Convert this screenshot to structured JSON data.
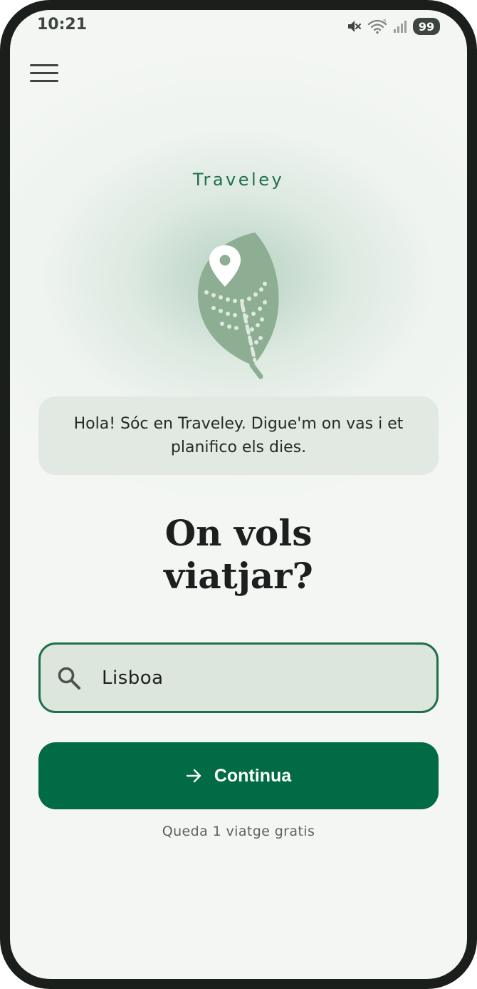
{
  "status_bar": {
    "time": "10:21",
    "battery": "99",
    "icons": [
      "mute-icon",
      "wifi-icon",
      "signal-icon"
    ]
  },
  "header": {
    "menu_icon": "hamburger-menu-icon",
    "brand": "Traveley"
  },
  "logo": {
    "icon": "leaf-map-pin-icon",
    "colors": {
      "leaf": "#8dae93",
      "dots": "#dfeadf",
      "pin": "#ffffff"
    }
  },
  "assistant": {
    "message": "Hola! Sóc en Traveley. Digue'm on vas i et planifico els dies."
  },
  "prompt": {
    "line1": "On vols",
    "line2": "viatjar?"
  },
  "search": {
    "icon": "search-icon",
    "value": "Lisboa",
    "placeholder": ""
  },
  "actions": {
    "continue_label": "Continua",
    "continue_icon": "arrow-right-icon",
    "remaining_trips": "Queda 1 viatge gratis"
  },
  "colors": {
    "accent": "#006b45",
    "brand_text": "#1f6f4a",
    "background": "#f3f6f3",
    "bubble": "#e1e9e2",
    "input_bg": "#dde6dc"
  }
}
